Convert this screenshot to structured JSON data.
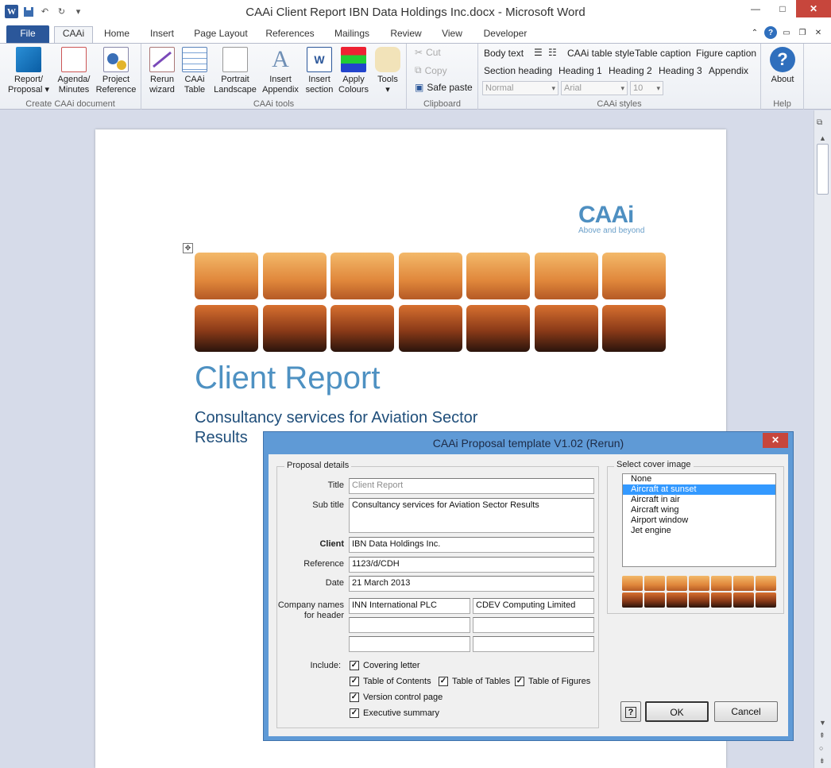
{
  "app": {
    "title": "CAAi Client Report IBN Data Holdings Inc.docx - Microsoft Word",
    "qat_icons": [
      "word-icon",
      "save-icon",
      "undo-icon",
      "redo-icon",
      "customize-icon"
    ]
  },
  "tabs": [
    "File",
    "CAAi",
    "Home",
    "Insert",
    "Page Layout",
    "References",
    "Mailings",
    "Review",
    "View",
    "Developer"
  ],
  "ribbon": {
    "create": {
      "label": "Create CAAi document",
      "report": "Report/ Proposal",
      "agenda": "Agenda/ Minutes",
      "project": "Project Reference"
    },
    "tools": {
      "label": "CAAi tools",
      "rerun": "Rerun wizard",
      "table": "CAAi Table",
      "portrait": "Portrait Landscape",
      "appendix": "Insert Appendix",
      "section": "Insert section",
      "colours": "Apply Colours",
      "toolsbtn": "Tools"
    },
    "clipboard": {
      "label": "Clipboard",
      "cut": "Cut",
      "copy": "Copy",
      "paste": "Safe paste"
    },
    "styles": {
      "label": "CAAi styles",
      "row1": [
        "Body text",
        "CAAi table style",
        "Table caption",
        "Figure caption"
      ],
      "row2": [
        "Section heading",
        "Heading 1",
        "Heading 2",
        "Heading 3",
        "Appendix"
      ],
      "style_combo": "Normal",
      "font_combo": "Arial",
      "size_combo": "10"
    },
    "help": {
      "label": "Help",
      "about": "About"
    }
  },
  "document": {
    "logo": "CAAi",
    "logo_tagline": "Above and beyond",
    "title": "Client Report",
    "subtitle": "Consultancy services for Aviation Sector Results"
  },
  "dialog": {
    "title": "CAAi Proposal template   V1.02  (Rerun)",
    "details_legend": "Proposal details",
    "labels": {
      "title": "Title",
      "subtitle": "Sub title",
      "client": "Client",
      "reference": "Reference",
      "date": "Date",
      "company": "Company names for header",
      "include": "Include:"
    },
    "fields": {
      "title_placeholder": "Client Report",
      "subtitle": "Consultancy services for Aviation Sector Results",
      "client": "IBN Data Holdings Inc.",
      "reference": "1123/d/CDH",
      "date": "21 March 2013",
      "company1": "INN International PLC",
      "company2": "CDEV Computing Limited",
      "company3": "",
      "company4": "",
      "company5": "",
      "company6": ""
    },
    "checks": {
      "covering": "Covering letter",
      "toc": "Table of Contents",
      "tot": "Table of Tables",
      "tof": "Table of Figures",
      "version": "Version control page",
      "exec": "Executive summary"
    },
    "cover_legend": "Select cover image",
    "cover_options": [
      "None",
      "Aircraft at sunset",
      "Aircraft in air",
      "Aircraft wing",
      "Airport window",
      "Jet engine"
    ],
    "selected": "Aircraft at sunset",
    "ok": "OK",
    "cancel": "Cancel",
    "help": "?"
  },
  "colors": {
    "accent": "#2b579a",
    "title_blue": "#4e91c2",
    "dialog_frame": "#5f9ad6",
    "selection": "#3399ff"
  }
}
